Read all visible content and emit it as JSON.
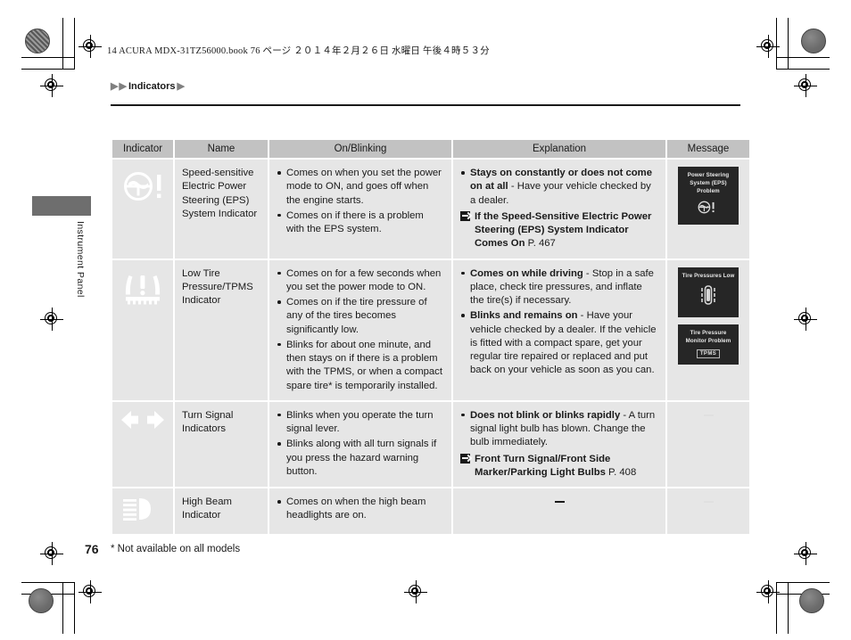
{
  "page": {
    "book_line": "14 ACURA MDX-31TZ56000.book  76 ページ  ２０１４年２月２６日  水曜日  午後４時５３分",
    "breadcrumb": "Indicators",
    "breadcrumb_marker": "▶",
    "side_tab_label": "Instrument Panel",
    "page_number": "76",
    "footnote": "* Not available on all models"
  },
  "table": {
    "headers": [
      "Indicator",
      "Name",
      "On/Blinking",
      "Explanation",
      "Message"
    ],
    "rows": [
      {
        "icon_name": "eps-steering-wheel-icon",
        "name": "Speed-sensitive Electric Power Steering (EPS) System Indicator",
        "on_blinking": [
          "Comes on when you set the power mode to ON, and goes off when the engine starts.",
          "Comes on if there is a problem with the EPS system."
        ],
        "explanation": [
          {
            "bold": "Stays on constantly or does not come on at all",
            "rest": " - Have your vehicle checked by a dealer."
          }
        ],
        "reference": {
          "title": "If the Speed-Sensitive Electric Power Steering (EPS) System Indicator Comes On",
          "page": "P. 467"
        },
        "messages": [
          {
            "lines": [
              "Power Steering",
              "System (EPS)",
              "Problem"
            ],
            "light_words": [
              "(EPS)"
            ],
            "glyph": "eps-steering-wheel-icon"
          }
        ],
        "message_dash": false
      },
      {
        "icon_name": "tpms-low-tire-pressure-icon",
        "name": "Low Tire Pressure/TPMS Indicator",
        "on_blinking": [
          "Comes on for a few seconds when you set the power mode to ON.",
          "Comes on if the tire pressure of any of the tires becomes significantly low.",
          "Blinks for about one minute, and then stays on if there is a problem with the TPMS, or when a compact spare tire* is temporarily installed."
        ],
        "explanation": [
          {
            "bold": "Comes on while driving",
            "rest": " - Stop in a safe place, check tire pressures, and inflate the tire(s) if necessary."
          },
          {
            "bold": "Blinks and remains on",
            "rest": " - Have your vehicle checked by a dealer. If the vehicle is fitted with a compact spare, get your regular tire repaired or replaced and put back on your vehicle as soon as you can."
          }
        ],
        "reference": null,
        "messages": [
          {
            "lines": [
              "Tire Pressures Low"
            ],
            "light_words": [],
            "glyph": "car-tire-pressure-icon"
          },
          {
            "lines": [
              "Tire Pressure",
              "Monitor Problem"
            ],
            "light_words": [],
            "glyph": "tpms-badge",
            "badge": "TPMS"
          }
        ],
        "message_dash": false
      },
      {
        "icon_name": "turn-signal-arrows-icon",
        "name": "Turn Signal Indicators",
        "on_blinking": [
          "Blinks when you operate the turn signal lever.",
          "Blinks along with all turn signals if you press the hazard warning button."
        ],
        "explanation": [
          {
            "bold": "Does not blink or blinks rapidly",
            "rest": " - A turn signal light bulb has blown. Change the bulb immediately."
          }
        ],
        "reference": {
          "title": "Front Turn Signal/Front Side Marker/Parking Light Bulbs",
          "page": "P. 408"
        },
        "messages": [],
        "message_dash": true
      },
      {
        "icon_name": "high-beam-headlight-icon",
        "name": "High Beam Indicator",
        "on_blinking": [
          "Comes on when the high beam headlights are on."
        ],
        "explanation": [],
        "explanation_dash": true,
        "reference": null,
        "messages": [],
        "message_dash": true
      }
    ]
  },
  "colors": {
    "header_bg": "#c2c2c2",
    "cell_bg": "#e6e6e6",
    "icon_cell_bg": "#4a4a4a",
    "tile_bg": "#262626",
    "text": "#1a1a1a"
  }
}
